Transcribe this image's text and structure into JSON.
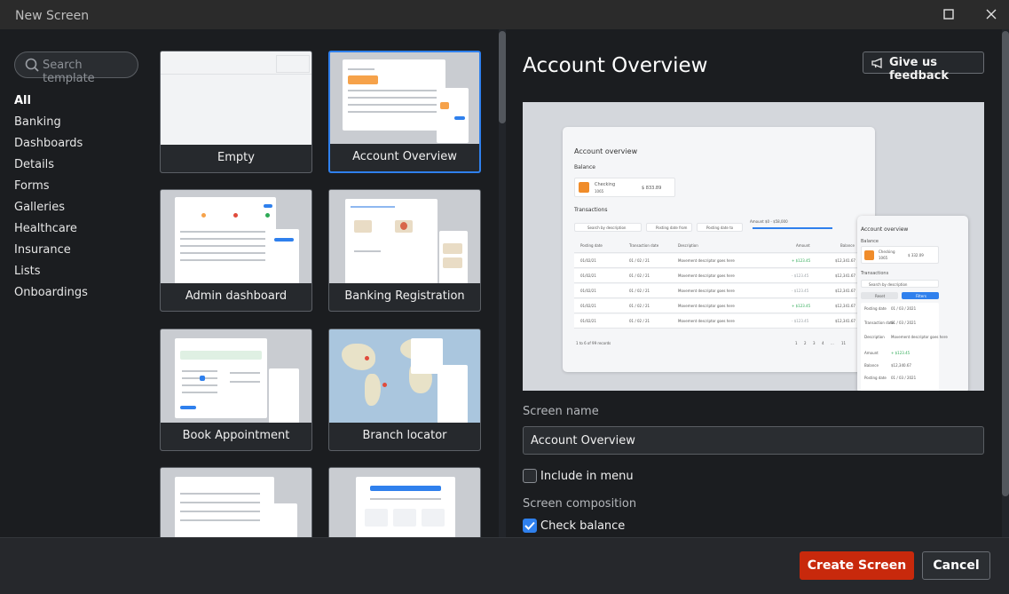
{
  "window": {
    "title": "New Screen"
  },
  "sidebar": {
    "search_placeholder": "Search template",
    "categories": [
      "All",
      "Banking",
      "Dashboards",
      "Details",
      "Forms",
      "Galleries",
      "Healthcare",
      "Insurance",
      "Lists",
      "Onboardings"
    ],
    "active": "All"
  },
  "templates": [
    "Empty",
    "Account Overview",
    "Admin dashboard",
    "Banking Registration",
    "Book Appointment",
    "Branch locator",
    "",
    ""
  ],
  "selected_template": "Account Overview",
  "details": {
    "title": "Account Overview",
    "feedback_label": "Give us feedback",
    "screen_name_label": "Screen name",
    "screen_name_value": "Account Overview",
    "include_in_menu_label": "Include in menu",
    "include_in_menu_checked": false,
    "composition_label": "Screen composition",
    "check_balance_label": "Check balance",
    "check_balance_checked": true
  },
  "preview": {
    "heading": "Account overview",
    "balance_label": "Balance",
    "account_name": "Checking",
    "account_sub": "1065",
    "account_amount": "$ 833.89",
    "transactions_label": "Transactions",
    "search_placeholder": "Search by description",
    "posting_from": "Posting date from",
    "posting_to": "Posting date to",
    "amount_label": "Amount",
    "amount_range": "$0 - $58,000",
    "columns": [
      "Posting date",
      "Transaction date",
      "Description",
      "Amount",
      "Balance"
    ],
    "rows": [
      [
        "01/02/21",
        "01 / 02 / 21",
        "Movement descriptor goes here",
        "+ $123.45",
        "$12,341.67"
      ],
      [
        "01/02/21",
        "01 / 02 / 21",
        "Movement descriptor goes here",
        "- $123.45",
        "$12,341.67"
      ],
      [
        "01/02/21",
        "01 / 02 / 21",
        "Movement descriptor goes here",
        "- $123.45",
        "$12,341.67"
      ],
      [
        "01/02/21",
        "01 / 02 / 21",
        "Movement descriptor goes here",
        "+ $123.45",
        "$12,341.67"
      ],
      [
        "01/02/21",
        "01 / 02 / 21",
        "Movement descriptor goes here",
        "- $123.45",
        "$12,341.67"
      ]
    ],
    "pagination_info": "1 to 6 of 99 records",
    "pages": [
      "1",
      "2",
      "3",
      "4",
      "...",
      "11"
    ],
    "mobile": {
      "heading": "Account overview",
      "balance_label": "Balance",
      "account_name": "Checking",
      "account_sub": "1065",
      "account_amount": "$ 332.09",
      "transactions_label": "Transactions",
      "search_placeholder": "Search by description",
      "btn_reset": "Reset",
      "btn_filter": "Filters",
      "fields": [
        [
          "Posting date",
          "01 / 03 / 2021"
        ],
        [
          "Transaction date",
          "01 / 03 / 2021"
        ],
        [
          "Description",
          "Movement descriptor goes here"
        ],
        [
          "Amount",
          "+ $123.45"
        ],
        [
          "Balance",
          "$12,340.67"
        ],
        [
          "Posting date",
          "01 / 03 / 2021"
        ]
      ]
    }
  },
  "footer": {
    "create_label": "Create Screen",
    "cancel_label": "Cancel"
  },
  "colors": {
    "accent": "#2f80ed",
    "create": "#c8290c",
    "positive": "#2eaa56",
    "negative": "#9aa0a6"
  }
}
